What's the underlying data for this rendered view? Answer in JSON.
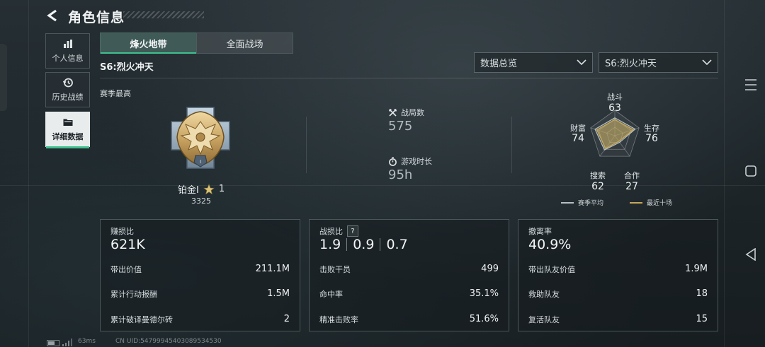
{
  "header": {
    "title": "角色信息"
  },
  "nav": [
    {
      "label": "个人信息",
      "icon": "bar-chart-icon",
      "active": false
    },
    {
      "label": "历史战绩",
      "icon": "history-icon",
      "active": false
    },
    {
      "label": "详细数据",
      "icon": "folder-icon",
      "active": true
    }
  ],
  "tabs": [
    {
      "label": "烽火地带",
      "active": true
    },
    {
      "label": "全面战场",
      "active": false
    }
  ],
  "season_label": "S6:烈火冲天",
  "filters": {
    "overview": "数据总览",
    "season": "S6:烈火冲天"
  },
  "season_best": {
    "label": "赛季最高",
    "rank_name": "铂金I",
    "stars": "1",
    "score": "3325"
  },
  "center_stats": {
    "matches_label": "战局数",
    "matches_value": "575",
    "playtime_label": "游戏时长",
    "playtime_value": "95h"
  },
  "radar": {
    "axes": [
      {
        "label": "战斗",
        "value": "63"
      },
      {
        "label": "生存",
        "value": "76"
      },
      {
        "label": "合作",
        "value": "27"
      },
      {
        "label": "搜索",
        "value": "62"
      },
      {
        "label": "财富",
        "value": "74"
      }
    ],
    "legend_season_avg": "赛季平均",
    "legend_recent": "最近十场",
    "colors": {
      "season_avg": "#b9c0c3",
      "recent": "#c5a85a"
    }
  },
  "cards": {
    "profit": {
      "title": "赚损比",
      "value": "621K",
      "rows": [
        {
          "label": "带出价值",
          "value": "211.1M"
        },
        {
          "label": "累计行动报酬",
          "value": "1.5M"
        },
        {
          "label": "累计破译曼德尔砖",
          "value": "2"
        }
      ]
    },
    "kd": {
      "title": "战损比",
      "help": "?",
      "values": [
        "1.9",
        "0.9",
        "0.7"
      ],
      "rows": [
        {
          "label": "击败干员",
          "value": "499"
        },
        {
          "label": "命中率",
          "value": "35.1%"
        },
        {
          "label": "精准击败率",
          "value": "51.6%"
        }
      ]
    },
    "extract": {
      "title": "撤离率",
      "value": "40.9%",
      "rows": [
        {
          "label": "带出队友价值",
          "value": "1.9M"
        },
        {
          "label": "救助队友",
          "value": "18"
        },
        {
          "label": "复活队友",
          "value": "15"
        }
      ]
    }
  },
  "footer": {
    "ping": "63ms",
    "uid": "CN UID:54799945403089534530"
  },
  "accent": "#3fc08f"
}
